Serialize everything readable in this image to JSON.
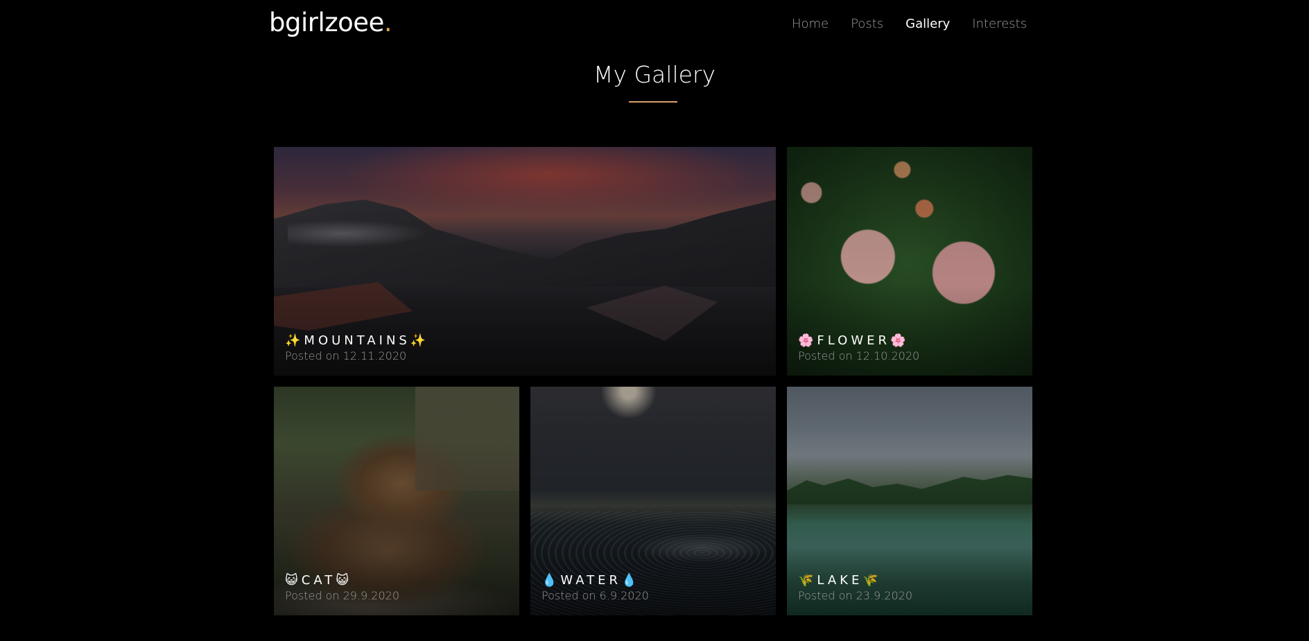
{
  "site": {
    "logo_text": "bgirlzoee",
    "logo_dot": "."
  },
  "nav": {
    "items": [
      {
        "label": "Home"
      },
      {
        "label": "Posts"
      },
      {
        "label": "Gallery"
      },
      {
        "label": "Interests"
      }
    ],
    "active": "Gallery"
  },
  "page": {
    "title": "My Gallery"
  },
  "gallery": {
    "items": [
      {
        "title": "✨MOUNTAINS✨",
        "date": "Posted on 12.11.2020"
      },
      {
        "title": "🌸FLOWER🌸",
        "date": "Posted on 12.10.2020"
      },
      {
        "title": "😺CAT😺",
        "date": "Posted on 29.9.2020"
      },
      {
        "title": "💧WATER💧",
        "date": "Posted on 6.9.2020"
      },
      {
        "title": "🌾LAKE🌾",
        "date": "Posted on 23.9.2020"
      }
    ]
  },
  "colors": {
    "background": "#000000",
    "accent": "#d9a066",
    "nav_inactive": "#a0a0a0",
    "nav_active": "#ffffff",
    "caption_date": "#9a9a9a"
  }
}
